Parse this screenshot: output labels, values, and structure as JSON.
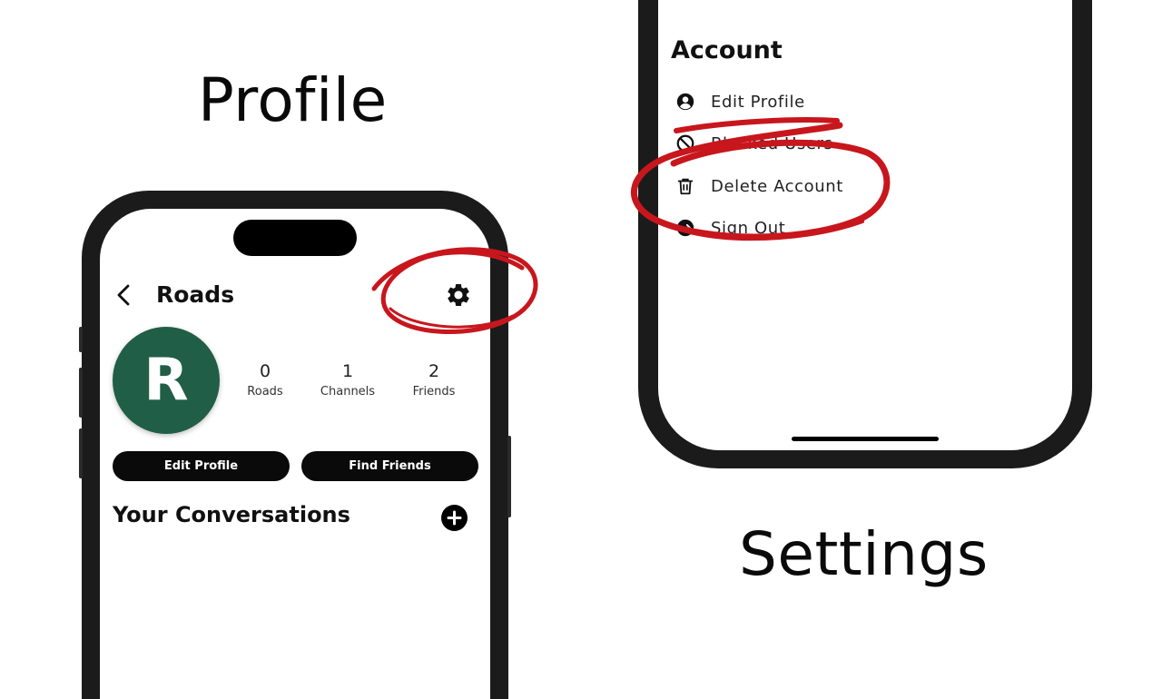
{
  "captions": {
    "left": "Profile",
    "right": "Settings"
  },
  "profile_screen": {
    "nav": {
      "title": "Roads"
    },
    "avatar": {
      "initial": "R"
    },
    "stats": [
      {
        "value": "0",
        "label": "Roads"
      },
      {
        "value": "1",
        "label": "Channels"
      },
      {
        "value": "2",
        "label": "Friends"
      }
    ],
    "buttons": {
      "edit_profile": "Edit Profile",
      "find_friends": "Find Friends"
    },
    "section_title": "Your Conversations"
  },
  "settings_screen": {
    "section_title": "Account",
    "items": [
      {
        "label": "Edit Profile",
        "icon": "user-circle-icon"
      },
      {
        "label": "Blocked Users",
        "icon": "block-icon"
      },
      {
        "label": "Delete Account",
        "icon": "trash-icon"
      },
      {
        "label": "Sign Out",
        "icon": "sign-out-icon"
      }
    ]
  },
  "colors": {
    "avatar_bg": "#205e47",
    "annotation_red": "#c8161d"
  }
}
